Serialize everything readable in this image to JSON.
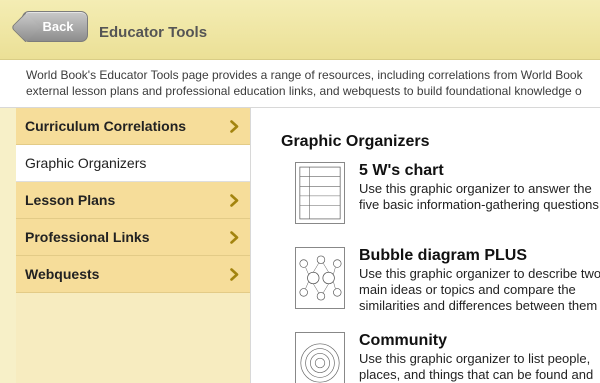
{
  "header": {
    "back_label": "Back",
    "title": "Educator Tools"
  },
  "description": {
    "line1": "World Book's Educator Tools page provides a range of resources, including correlations from World Book",
    "line2": "external lesson plans and professional education links, and webquests to build foundational knowledge o"
  },
  "sidebar": {
    "items": [
      {
        "label": "Curriculum Correlations",
        "selected": false
      },
      {
        "label": "Graphic Organizers",
        "selected": true
      },
      {
        "label": "Lesson Plans",
        "selected": false
      },
      {
        "label": "Professional Links",
        "selected": false
      },
      {
        "label": "Webquests",
        "selected": false
      }
    ]
  },
  "main": {
    "title": "Graphic Organizers",
    "organizers": [
      {
        "name": "5 W's chart",
        "desc": "Use this graphic organizer to answer the five basic information-gathering questions"
      },
      {
        "name": "Bubble diagram PLUS",
        "desc": "Use this graphic organizer to describe two main ideas or topics and compare the similarities and differences between them"
      },
      {
        "name": "Community",
        "desc": "Use this graphic organizer to list people, places, and things that can be found and"
      }
    ]
  },
  "colors": {
    "header_bg": "#ebe096",
    "sidebar_item_bg": "#f6dd9a",
    "chevron": "#a3840f"
  }
}
